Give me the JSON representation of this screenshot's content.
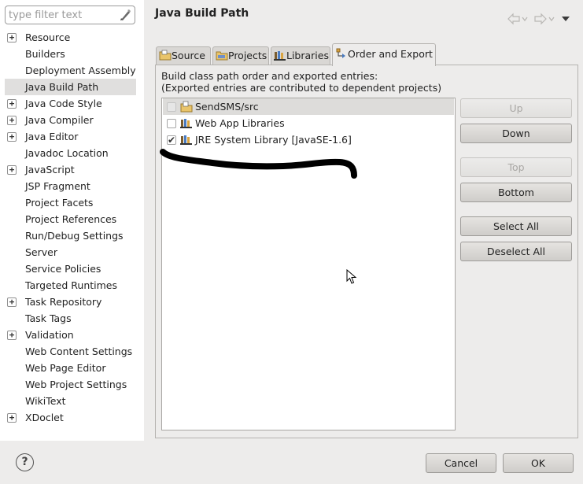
{
  "sidebar": {
    "filter_placeholder": "type filter text",
    "items": [
      {
        "label": "Resource",
        "expandable": true
      },
      {
        "label": "Builders",
        "expandable": false
      },
      {
        "label": "Deployment Assembly",
        "expandable": false
      },
      {
        "label": "Java Build Path",
        "expandable": false,
        "selected": true
      },
      {
        "label": "Java Code Style",
        "expandable": true
      },
      {
        "label": "Java Compiler",
        "expandable": true
      },
      {
        "label": "Java Editor",
        "expandable": true
      },
      {
        "label": "Javadoc Location",
        "expandable": false
      },
      {
        "label": "JavaScript",
        "expandable": true
      },
      {
        "label": "JSP Fragment",
        "expandable": false
      },
      {
        "label": "Project Facets",
        "expandable": false
      },
      {
        "label": "Project References",
        "expandable": false
      },
      {
        "label": "Run/Debug Settings",
        "expandable": false
      },
      {
        "label": "Server",
        "expandable": false
      },
      {
        "label": "Service Policies",
        "expandable": false
      },
      {
        "label": "Targeted Runtimes",
        "expandable": false
      },
      {
        "label": "Task Repository",
        "expandable": true
      },
      {
        "label": "Task Tags",
        "expandable": false
      },
      {
        "label": "Validation",
        "expandable": true
      },
      {
        "label": "Web Content Settings",
        "expandable": false
      },
      {
        "label": "Web Page Editor",
        "expandable": false
      },
      {
        "label": "Web Project Settings",
        "expandable": false
      },
      {
        "label": "WikiText",
        "expandable": false
      },
      {
        "label": "XDoclet",
        "expandable": true
      }
    ],
    "expander_glyph": "+"
  },
  "header": {
    "title": "Java Build Path"
  },
  "tabs": [
    {
      "label": "Source",
      "icon": "source-folder-icon"
    },
    {
      "label": "Projects",
      "icon": "projects-icon"
    },
    {
      "label": "Libraries",
      "icon": "libraries-icon"
    },
    {
      "label": "Order and Export",
      "icon": "order-export-icon",
      "active": true
    }
  ],
  "order_export": {
    "description_line1": "Build class path order and exported entries:",
    "description_line2": "(Exported entries are contributed to dependent projects)",
    "entries": [
      {
        "label": "SendSMS/src",
        "checked": false,
        "disabled": true,
        "selected": true,
        "icon": "source-folder-icon"
      },
      {
        "label": "Web App Libraries",
        "checked": false,
        "disabled": false,
        "selected": false,
        "icon": "library-icon"
      },
      {
        "label": "JRE System Library [JavaSE-1.6]",
        "checked": true,
        "disabled": false,
        "selected": false,
        "icon": "library-icon"
      }
    ],
    "check_glyph": "✔"
  },
  "buttons": {
    "up": "Up",
    "down": "Down",
    "top": "Top",
    "bottom": "Bottom",
    "select_all": "Select All",
    "deselect_all": "Deselect All"
  },
  "dialog": {
    "help_glyph": "?",
    "cancel": "Cancel",
    "ok": "OK"
  },
  "colors": {
    "background": "#edeceb",
    "sidebar_background": "#ffffff",
    "selection": "#e0dfde",
    "disabled_text": "#a9a7a4",
    "scribble": "#000000"
  }
}
